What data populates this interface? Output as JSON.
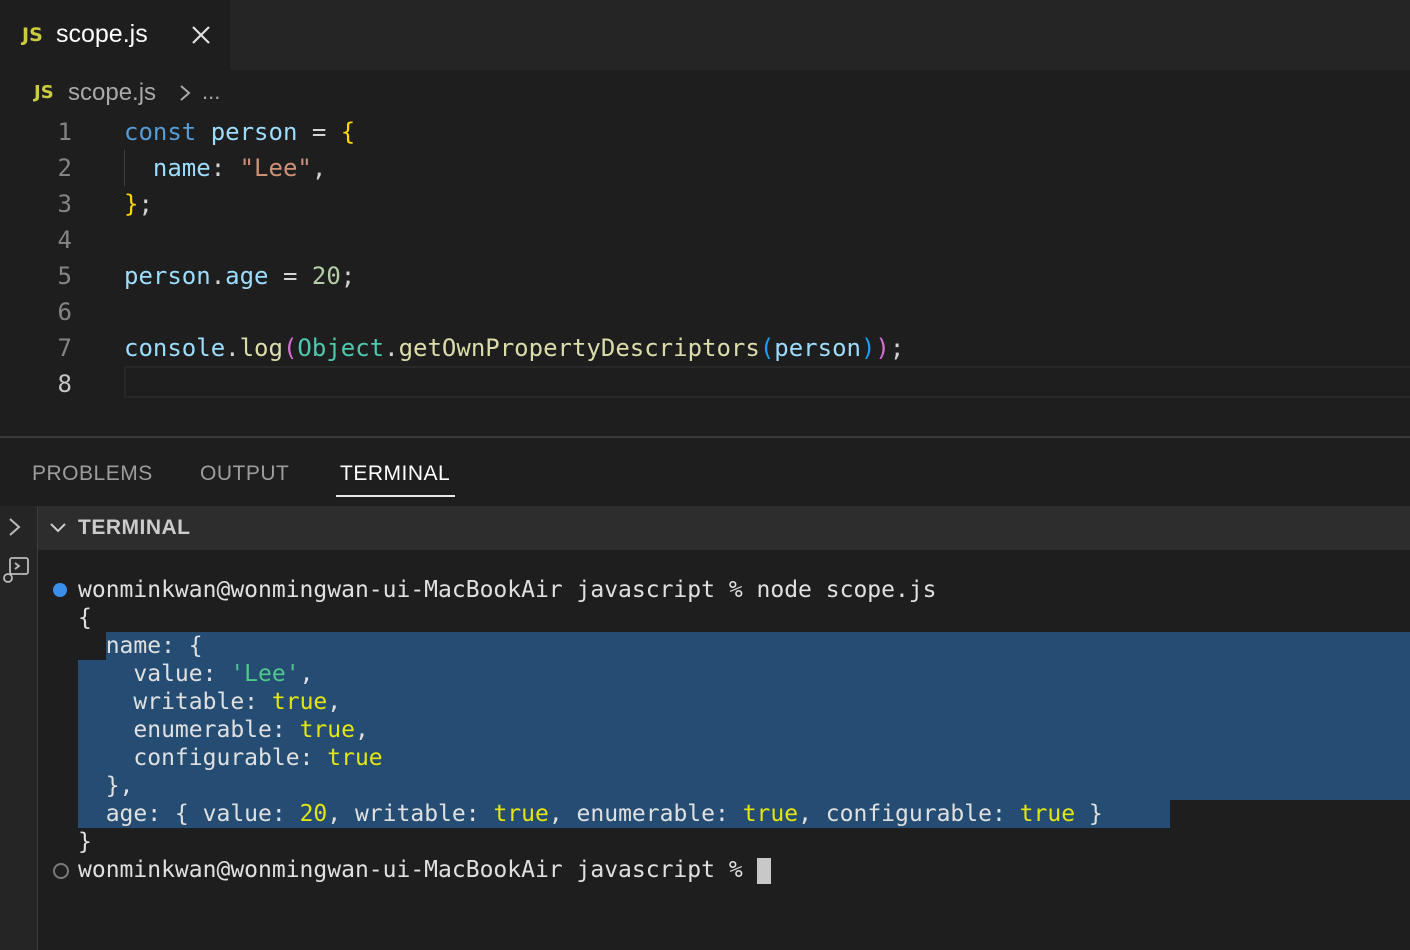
{
  "tab": {
    "icon": "JS",
    "label": "scope.js"
  },
  "breadcrumb": {
    "icon": "JS",
    "file": "scope.js",
    "more": "..."
  },
  "editor": {
    "line_numbers": [
      "1",
      "2",
      "3",
      "4",
      "5",
      "6",
      "7",
      "8"
    ],
    "lines": [
      "const person = {",
      "  name: \"Lee\",",
      "};",
      "",
      "person.age = 20;",
      "",
      "console.log(Object.getOwnPropertyDescriptors(person));",
      ""
    ]
  },
  "panel": {
    "tabs": [
      "PROBLEMS",
      "OUTPUT",
      "TERMINAL"
    ],
    "active_tab": "TERMINAL",
    "terminal_header": "TERMINAL",
    "prompt": "wonminkwan@wonmingwan-ui-MacBookAir javascript % ",
    "command": "node scope.js",
    "output": [
      "{",
      "  name: {",
      "    value: 'Lee',",
      "    writable: true,",
      "    enumerable: true,",
      "    configurable: true",
      "  },",
      "  age: { value: 20, writable: true, enumerable: true, configurable: true }",
      "}"
    ]
  },
  "colors": {
    "background": "#1e1e1e",
    "selection": "#264f78",
    "js_icon": "#cbcb41",
    "status_dot": "#3b8eea"
  },
  "icons": [
    "js-file-icon",
    "close-icon",
    "chevron-right-icon",
    "chevron-down-icon",
    "terminal-icon"
  ]
}
